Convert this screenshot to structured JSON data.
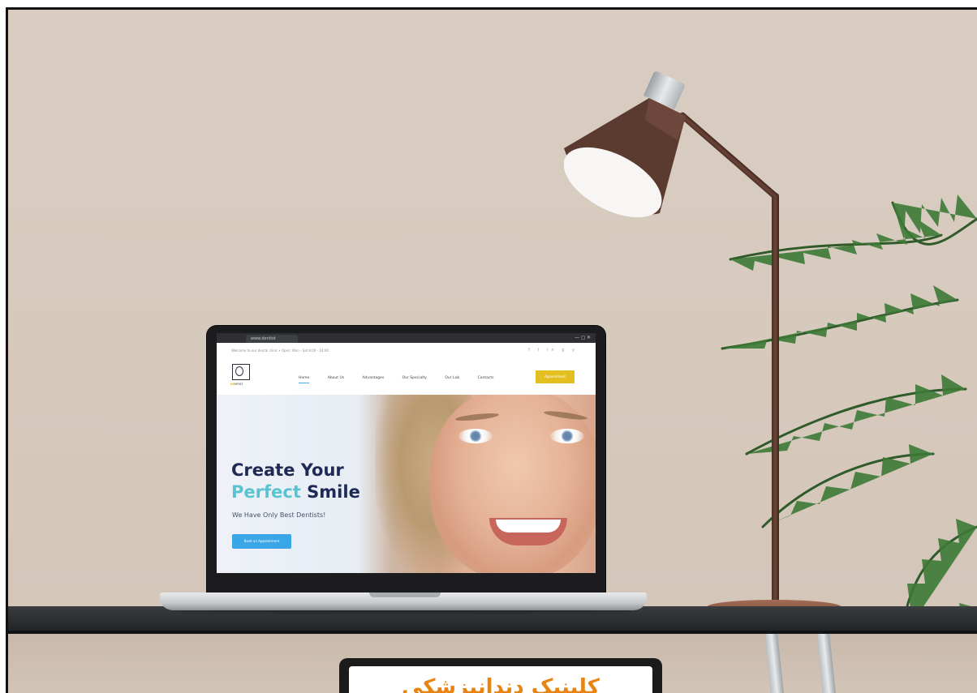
{
  "scene": {
    "sign_text": "کلینیک دندانپزشکی"
  },
  "browser": {
    "tab_title": "www.dentist",
    "window_controls": "— ◻ ✕"
  },
  "site": {
    "topbar_text": "Welcome to our dental clinic • Open: Mon - Sat 9:00 - 18:00",
    "social_icons": "f t in g y",
    "logo_brand_a": "DE",
    "logo_brand_b": "NTIST",
    "nav": [
      {
        "label": "Home"
      },
      {
        "label": "About Us"
      },
      {
        "label": "Advantages"
      },
      {
        "label": "Our Specialty"
      },
      {
        "label": "Our Lab"
      },
      {
        "label": "Contacts"
      }
    ],
    "cta_label": "Appointment",
    "hero": {
      "title_line1": "Create Your",
      "title_accent": "Perfect",
      "title_rest": " Smile",
      "subtitle": "We Have Only Best Dentists!",
      "button_label": "Book an Appointment"
    }
  },
  "colors": {
    "accent_teal": "#5ac3d1",
    "title_navy": "#1e2a55",
    "cta_yellow": "#e3bf22",
    "hero_button_blue": "#3aa6e8",
    "sign_text_orange": "#e98312"
  }
}
